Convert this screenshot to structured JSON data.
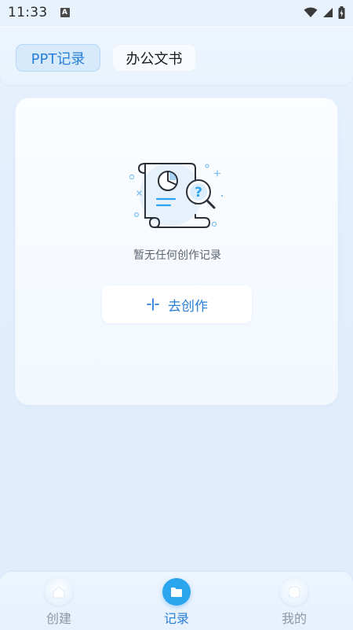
{
  "status_bar": {
    "time": "11:33",
    "notification_icon": "A"
  },
  "tabs": [
    {
      "label": "PPT记录",
      "selected": true
    },
    {
      "label": "办公文书",
      "selected": false
    }
  ],
  "empty_state": {
    "message": "暂无任何创作记录",
    "button_label": "去创作"
  },
  "bottom_nav": [
    {
      "label": "创建",
      "icon": "home-icon",
      "active": false
    },
    {
      "label": "记录",
      "icon": "folder-icon",
      "active": true
    },
    {
      "label": "我的",
      "icon": "profile-icon",
      "active": false
    }
  ],
  "colors": {
    "accent": "#2a7fd6",
    "active_nav": "#2aa5ee",
    "tab_selected_bg": "#d6eafc"
  }
}
